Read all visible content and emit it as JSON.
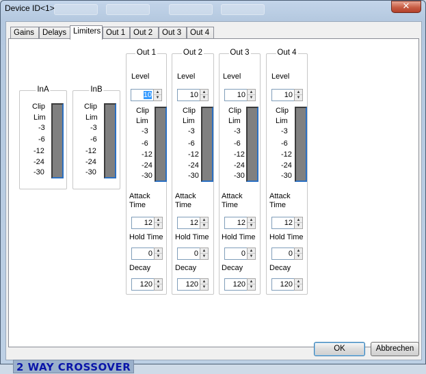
{
  "window": {
    "title": "Device ID<1>",
    "close_glyph": "✕"
  },
  "tabs": [
    {
      "label": "Gains"
    },
    {
      "label": "Delays"
    },
    {
      "label": "Limiters",
      "active": true
    },
    {
      "label": "Out 1"
    },
    {
      "label": "Out 2"
    },
    {
      "label": "Out 3"
    },
    {
      "label": "Out 4"
    }
  ],
  "meter_scale": [
    "Clip",
    "Lim",
    "-3",
    "-6",
    "-12",
    "-24",
    "-30"
  ],
  "inputs": [
    {
      "title": "InA"
    },
    {
      "title": "InB"
    }
  ],
  "outputs": [
    {
      "title": "Out 1",
      "level": "10",
      "level_selected": true,
      "attack": "12",
      "hold": "0",
      "decay": "120"
    },
    {
      "title": "Out 2",
      "level": "10",
      "attack": "12",
      "hold": "0",
      "decay": "120"
    },
    {
      "title": "Out 3",
      "level": "10",
      "attack": "12",
      "hold": "0",
      "decay": "120"
    },
    {
      "title": "Out 4",
      "level": "10",
      "attack": "12",
      "hold": "0",
      "decay": "120"
    }
  ],
  "field_labels": {
    "level": "Level",
    "attack_1": "Attack",
    "attack_2": "Time",
    "hold": "Hold Time",
    "decay": "Decay"
  },
  "footer": {
    "product_label": "2 WAY CROSSOVER",
    "ok_label": "OK",
    "cancel_label": "Abbrechen"
  },
  "colors": {
    "meter_fill": "#808080",
    "meter_edge_blue": "#2a6fc2",
    "product_label_text": "#0a15a8",
    "selection": "#3399ff"
  }
}
